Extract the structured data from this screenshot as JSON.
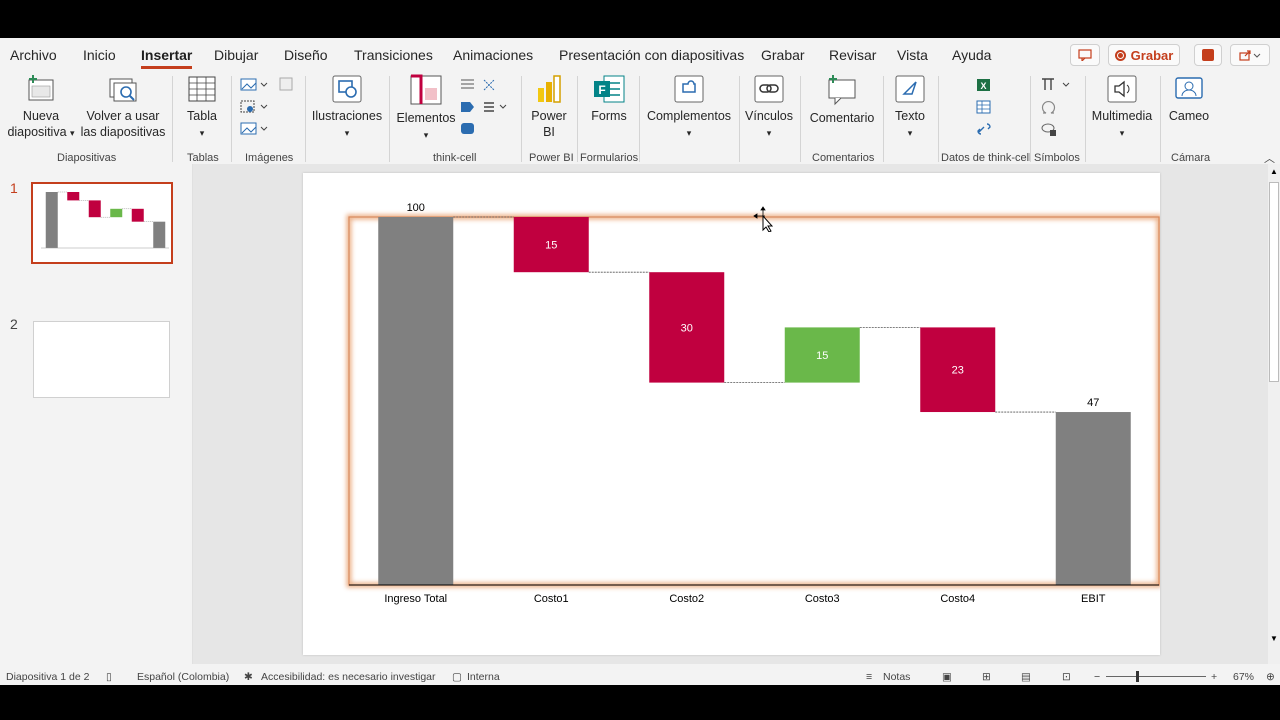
{
  "menu": {
    "tabs": [
      {
        "label": "Archivo"
      },
      {
        "label": "Inicio"
      },
      {
        "label": "Insertar"
      },
      {
        "label": "Dibujar"
      },
      {
        "label": "Diseño"
      },
      {
        "label": "Transiciones"
      },
      {
        "label": "Animaciones"
      },
      {
        "label": "Presentación con diapositivas"
      },
      {
        "label": "Grabar"
      },
      {
        "label": "Revisar"
      },
      {
        "label": "Vista"
      },
      {
        "label": "Ayuda"
      }
    ],
    "record_label": "Grabar"
  },
  "ribbon": {
    "new_slide": "Nueva\ndiapositiva",
    "reuse_slides": "Volver a usar\nlas diapositivas",
    "table": "Tabla",
    "illustrations": "Ilustraciones",
    "elements": "Elementos",
    "power_bi": "Power\nBI",
    "forms": "Forms",
    "addins": "Complementos",
    "links": "Vínculos",
    "comment": "Comentario",
    "text": "Texto",
    "media": "Multimedia",
    "cameo": "Cameo",
    "groups": {
      "slides": "Diapositivas",
      "tables": "Tablas",
      "images": "Imágenes",
      "thinkcell": "think-cell",
      "powerbi": "Power BI",
      "forms": "Formularios",
      "comments": "Comentarios",
      "thinkcell_data": "Datos de think-cell",
      "symbols": "Símbolos",
      "camera": "Cámara"
    }
  },
  "thumbnails": [
    {
      "number": "1"
    },
    {
      "number": "2"
    }
  ],
  "chart_data": {
    "type": "bar",
    "subtype": "waterfall",
    "categories": [
      "Ingreso Total",
      "Costo1",
      "Costo2",
      "Costo3",
      "Costo4",
      "EBIT"
    ],
    "values": [
      100,
      -15,
      -30,
      15,
      -23,
      47
    ],
    "labels": [
      "100",
      "15",
      "30",
      "15",
      "23",
      "47"
    ],
    "ylim": [
      0,
      100
    ],
    "colors": {
      "total": "#808080",
      "negative": "#c0003f",
      "positive": "#6ab84a"
    }
  },
  "status": {
    "slide_info": "Diapositiva 1 de 2",
    "language": "Español (Colombia)",
    "accessibility": "Accesibilidad: es necesario investigar",
    "sensitivity": "Interna",
    "notes": "Notas",
    "zoom": "67%"
  }
}
